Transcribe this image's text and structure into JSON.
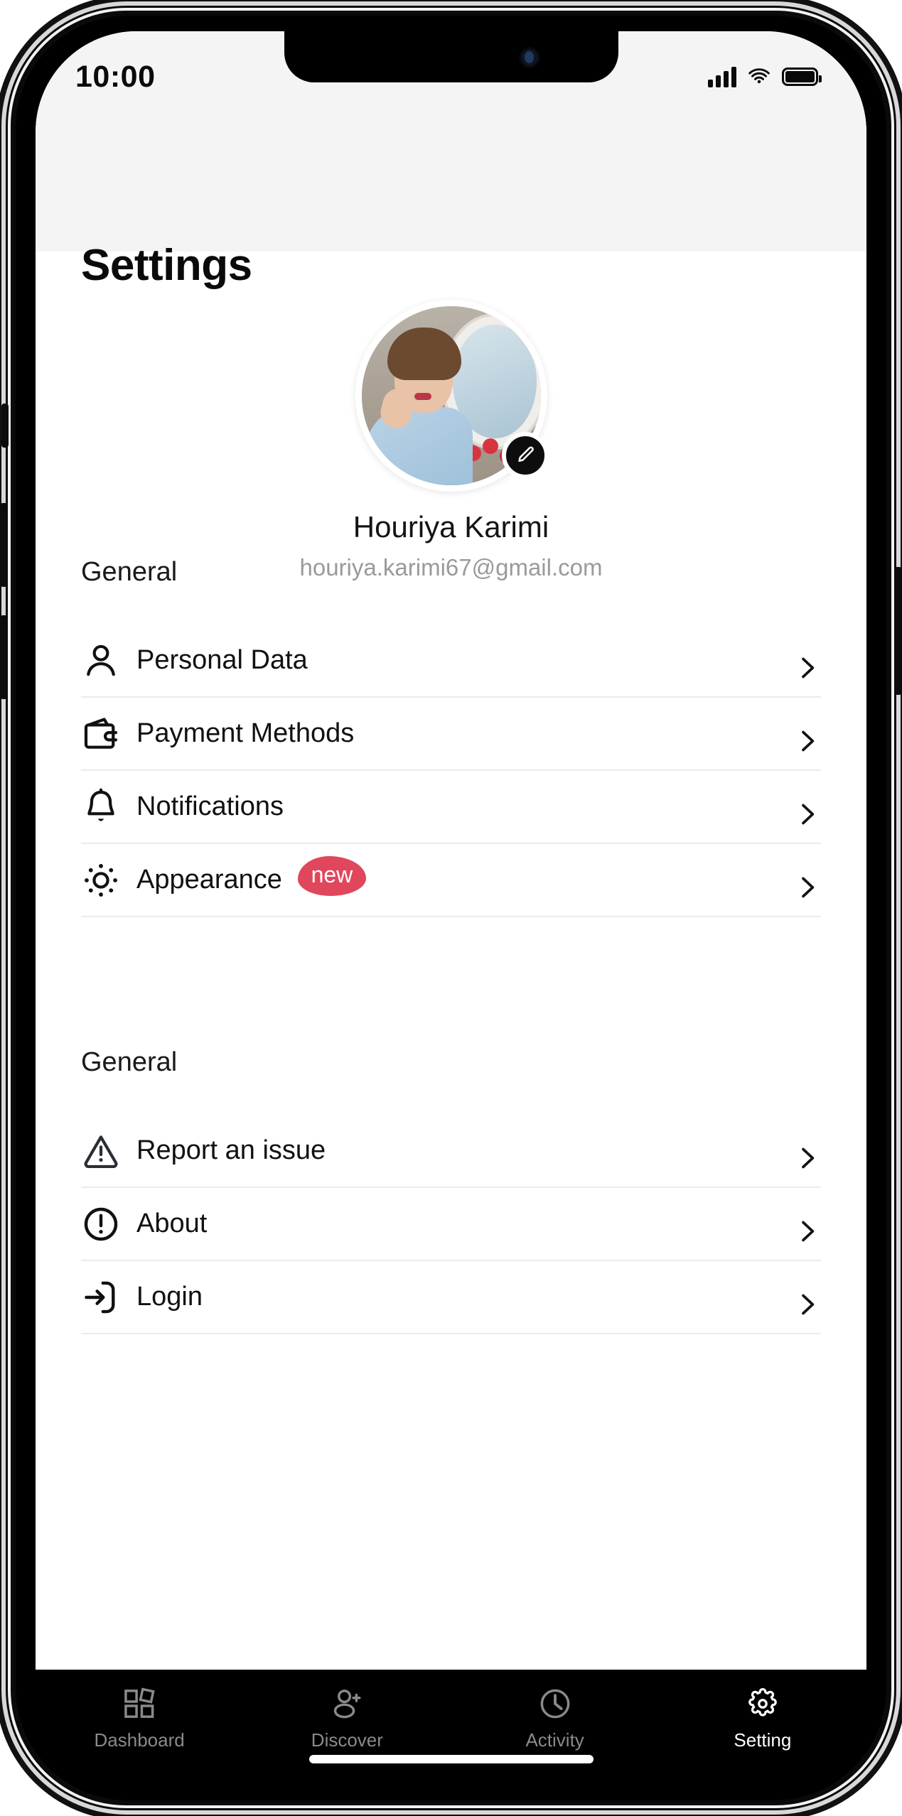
{
  "status_bar": {
    "time": "10:00",
    "signal_icon": "cellular-signal-icon",
    "wifi_icon": "wifi-icon",
    "battery_icon": "battery-full-icon"
  },
  "header": {
    "title": "Settings"
  },
  "profile": {
    "name": "Houriya Karimi",
    "email": "houriya.karimi67@gmail.com",
    "avatar_alt": "user-avatar",
    "edit_button_icon": "pencil-edit-icon"
  },
  "sections": [
    {
      "title": "General",
      "items": [
        {
          "label": "Personal Data",
          "icon": "user-icon",
          "badge": null,
          "chevron": "chevron-right-icon"
        },
        {
          "label": "Payment Methods",
          "icon": "wallet-icon",
          "badge": null,
          "chevron": "chevron-right-icon"
        },
        {
          "label": "Notifications",
          "icon": "bell-icon",
          "badge": null,
          "chevron": "chevron-right-icon"
        },
        {
          "label": "Appearance",
          "icon": "brightness-sun-icon",
          "badge": "new",
          "chevron": "chevron-right-icon"
        }
      ]
    },
    {
      "title": "General",
      "items": [
        {
          "label": "Report an issue",
          "icon": "warning-triangle-icon",
          "badge": null,
          "chevron": "chevron-right-icon"
        },
        {
          "label": "About",
          "icon": "info-circle-icon",
          "badge": null,
          "chevron": "chevron-right-icon"
        },
        {
          "label": "Login",
          "icon": "login-arrow-icon",
          "badge": null,
          "chevron": "chevron-right-icon"
        }
      ]
    }
  ],
  "bottom_nav": {
    "items": [
      {
        "label": "Dashboard",
        "icon": "grid-squares-icon",
        "active": false
      },
      {
        "label": "Discover",
        "icon": "user-plus-icon",
        "active": false
      },
      {
        "label": "Activity",
        "icon": "clock-icon",
        "active": false
      },
      {
        "label": "Setting",
        "icon": "gear-icon",
        "active": true
      }
    ]
  },
  "colors": {
    "badge_background": "#e0465c",
    "header_background": "#f4f4f5",
    "nav_background": "#000000",
    "nav_active": "#ffffff",
    "nav_inactive": "#8a8a8a",
    "email_text": "#9a9a9a"
  }
}
